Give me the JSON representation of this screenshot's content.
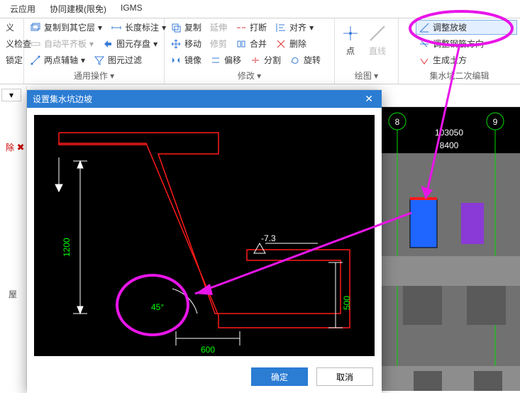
{
  "tabs": {
    "cloud": "云应用",
    "model": "协同建模(限免)",
    "igms": "IGMS"
  },
  "ribbon": {
    "g1": {
      "a": "义",
      "b": "义检查",
      "c": "锁定",
      "item1": "复制到其它层",
      "item2": "自动平齐板",
      "item3": "两点辅轴",
      "label": "通用操作"
    },
    "g2": {
      "a": "长度标注",
      "b": "图元存盘",
      "c": "图元过滤"
    },
    "g3": {
      "copy": "复制",
      "move": "移动",
      "mirror": "镜像",
      "extend": "延伸",
      "trim": "修剪",
      "offset": "偏移",
      "break": "打断",
      "merge": "合并",
      "split": "分割",
      "align": "对齐",
      "delete": "删除",
      "rotate": "旋转",
      "label": "修改"
    },
    "g4": {
      "point": "点",
      "line": "直线",
      "label": "绘图"
    },
    "g5": {
      "a": "调整放坡",
      "b": "调整钢筋方向",
      "c": "生成土方",
      "label": "集水坑二次编辑"
    }
  },
  "dialog": {
    "title": "设置集水坑边坡",
    "ok": "确定",
    "cancel": "取消"
  },
  "drawing": {
    "angle": "45°",
    "w": "600",
    "h": "1200",
    "d": "500",
    "elev": "-7.3"
  },
  "view": {
    "col8": "8",
    "col9": "9",
    "span1": "103050",
    "span2": "8400"
  },
  "left": {
    "v": "屋",
    "del": "除"
  }
}
